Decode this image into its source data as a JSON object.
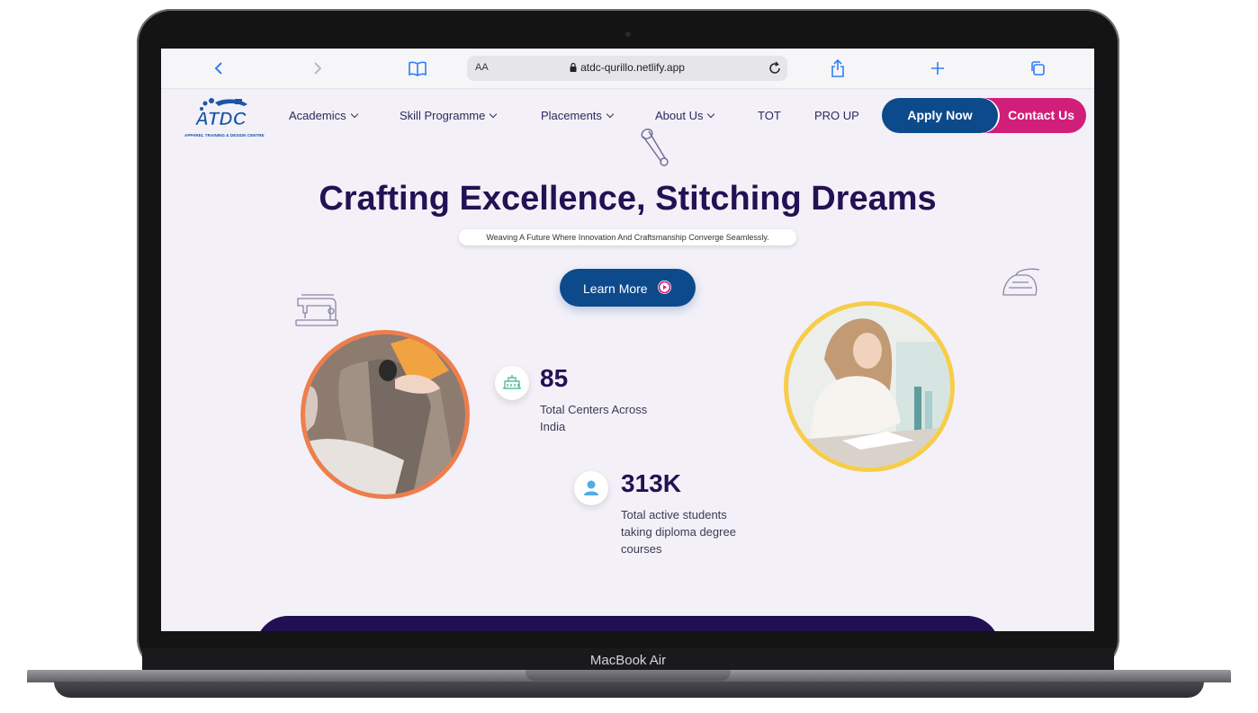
{
  "device": {
    "model_label": "MacBook Air"
  },
  "browser": {
    "text_size_label": "AA",
    "url": "atdc-qurillo.netlify.app",
    "icons": [
      "back-icon",
      "forward-icon",
      "bookmarks-icon",
      "lock-icon",
      "reload-icon",
      "share-icon",
      "new-tab-icon",
      "tabs-icon"
    ]
  },
  "site": {
    "logo_text": "ATDC",
    "logo_subtext": "APPAREL TRAINING & DESIGN CENTRE",
    "nav": [
      {
        "label": "Academics",
        "has_dropdown": true
      },
      {
        "label": "Skill Programme",
        "has_dropdown": true
      },
      {
        "label": "Placements",
        "has_dropdown": true
      },
      {
        "label": "About Us",
        "has_dropdown": true
      },
      {
        "label": "TOT",
        "has_dropdown": false
      },
      {
        "label": "PRO UP",
        "has_dropdown": false
      }
    ],
    "apply_label": "Apply Now",
    "contact_label": "Contact Us"
  },
  "hero": {
    "heading": "Crafting Excellence, Stitching Dreams",
    "subheading": "Weaving A Future Where Innovation And Craftsmanship Converge Seamlessly.",
    "cta_label": "Learn More",
    "decor_icons": [
      "safety-pin-icon",
      "sewing-machine-icon",
      "iron-icon"
    ]
  },
  "stats": [
    {
      "value": "85",
      "label": "Total Centers Across India",
      "icon": "building-icon"
    },
    {
      "value": "313K",
      "label": "Total active students taking diploma degree courses",
      "icon": "student-icon"
    }
  ],
  "colors": {
    "primary_blue": "#0d4a8c",
    "accent_pink": "#d11e7a",
    "heading_purple": "#241154",
    "page_bg": "#f3f0f8",
    "ring_orange": "#ee7e4c",
    "ring_yellow": "#f7cd48"
  }
}
